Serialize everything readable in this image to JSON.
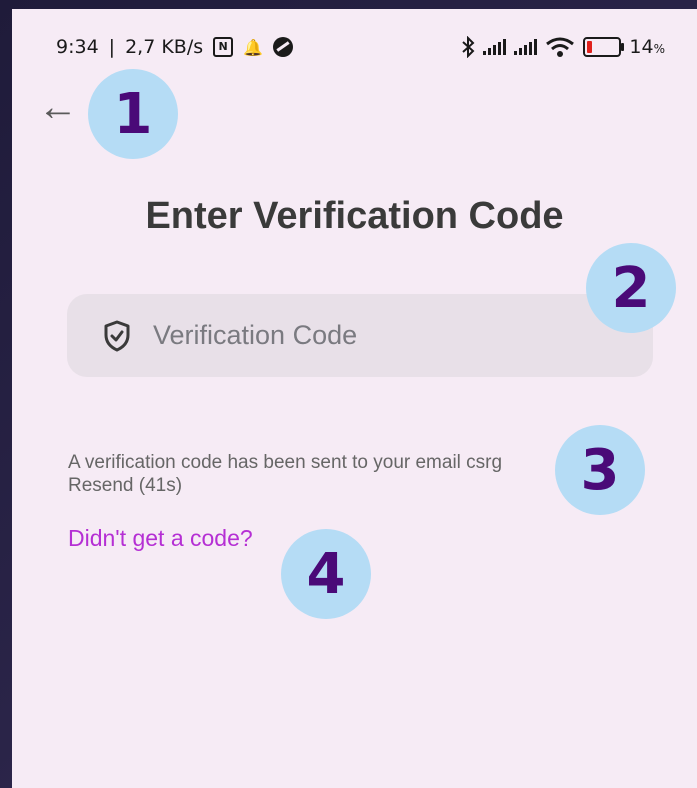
{
  "status_bar": {
    "time": "9:34",
    "separator": "|",
    "speed": "2,7 KB/s",
    "nfc_icon": "N",
    "battery_pct": "14",
    "battery_unit": "%",
    "battery_level": 0.14
  },
  "header": {
    "back_glyph": "←"
  },
  "page": {
    "title": "Enter Verification Code"
  },
  "code_field": {
    "placeholder": "Verification Code",
    "value": ""
  },
  "info": {
    "message": "A verification code has been sent to your email csrg",
    "resend_label": "Resend (41s)"
  },
  "help": {
    "link_label": "Didn't get a code?"
  },
  "badges": {
    "b1": "1",
    "b2": "2",
    "b3": "3",
    "b4": "4"
  },
  "colors": {
    "accent": "#b52fd4",
    "badge_bg": "#b5dcf5",
    "badge_text": "#4a0a78",
    "field_bg": "#e8e0e8",
    "page_bg": "#f6ebf5"
  }
}
